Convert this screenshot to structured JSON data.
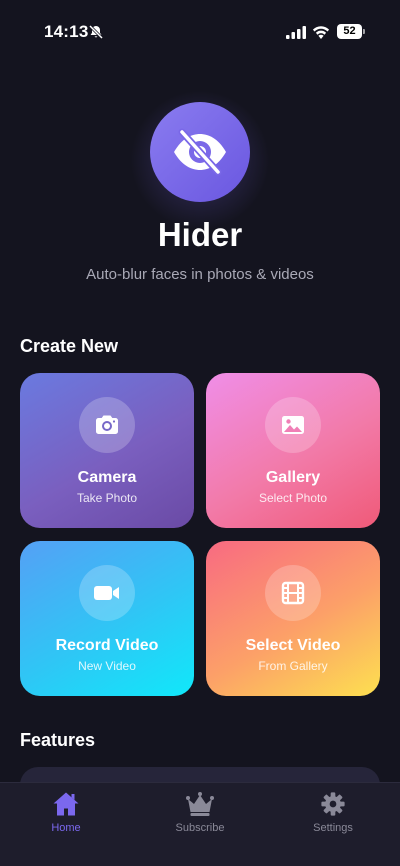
{
  "status": {
    "time": "14:13",
    "battery": "52"
  },
  "hero": {
    "title": "Hider",
    "subtitle": "Auto-blur faces in photos & videos",
    "logo_icon": "eye-slash-icon"
  },
  "sections": {
    "create_new": "Create New",
    "features": "Features"
  },
  "cards": [
    {
      "title": "Camera",
      "subtitle": "Take Photo",
      "icon": "camera-icon"
    },
    {
      "title": "Gallery",
      "subtitle": "Select Photo",
      "icon": "image-icon"
    },
    {
      "title": "Record Video",
      "subtitle": "New Video",
      "icon": "video-camera-icon"
    },
    {
      "title": "Select Video",
      "subtitle": "From Gallery",
      "icon": "film-icon"
    }
  ],
  "tabs": [
    {
      "label": "Home",
      "icon": "home-icon",
      "active": true
    },
    {
      "label": "Subscribe",
      "icon": "crown-icon",
      "active": false
    },
    {
      "label": "Settings",
      "icon": "gear-icon",
      "active": false
    }
  ],
  "colors": {
    "background": "#14141f",
    "accent": "#7b68ee",
    "tab_inactive": "#8a8998"
  }
}
